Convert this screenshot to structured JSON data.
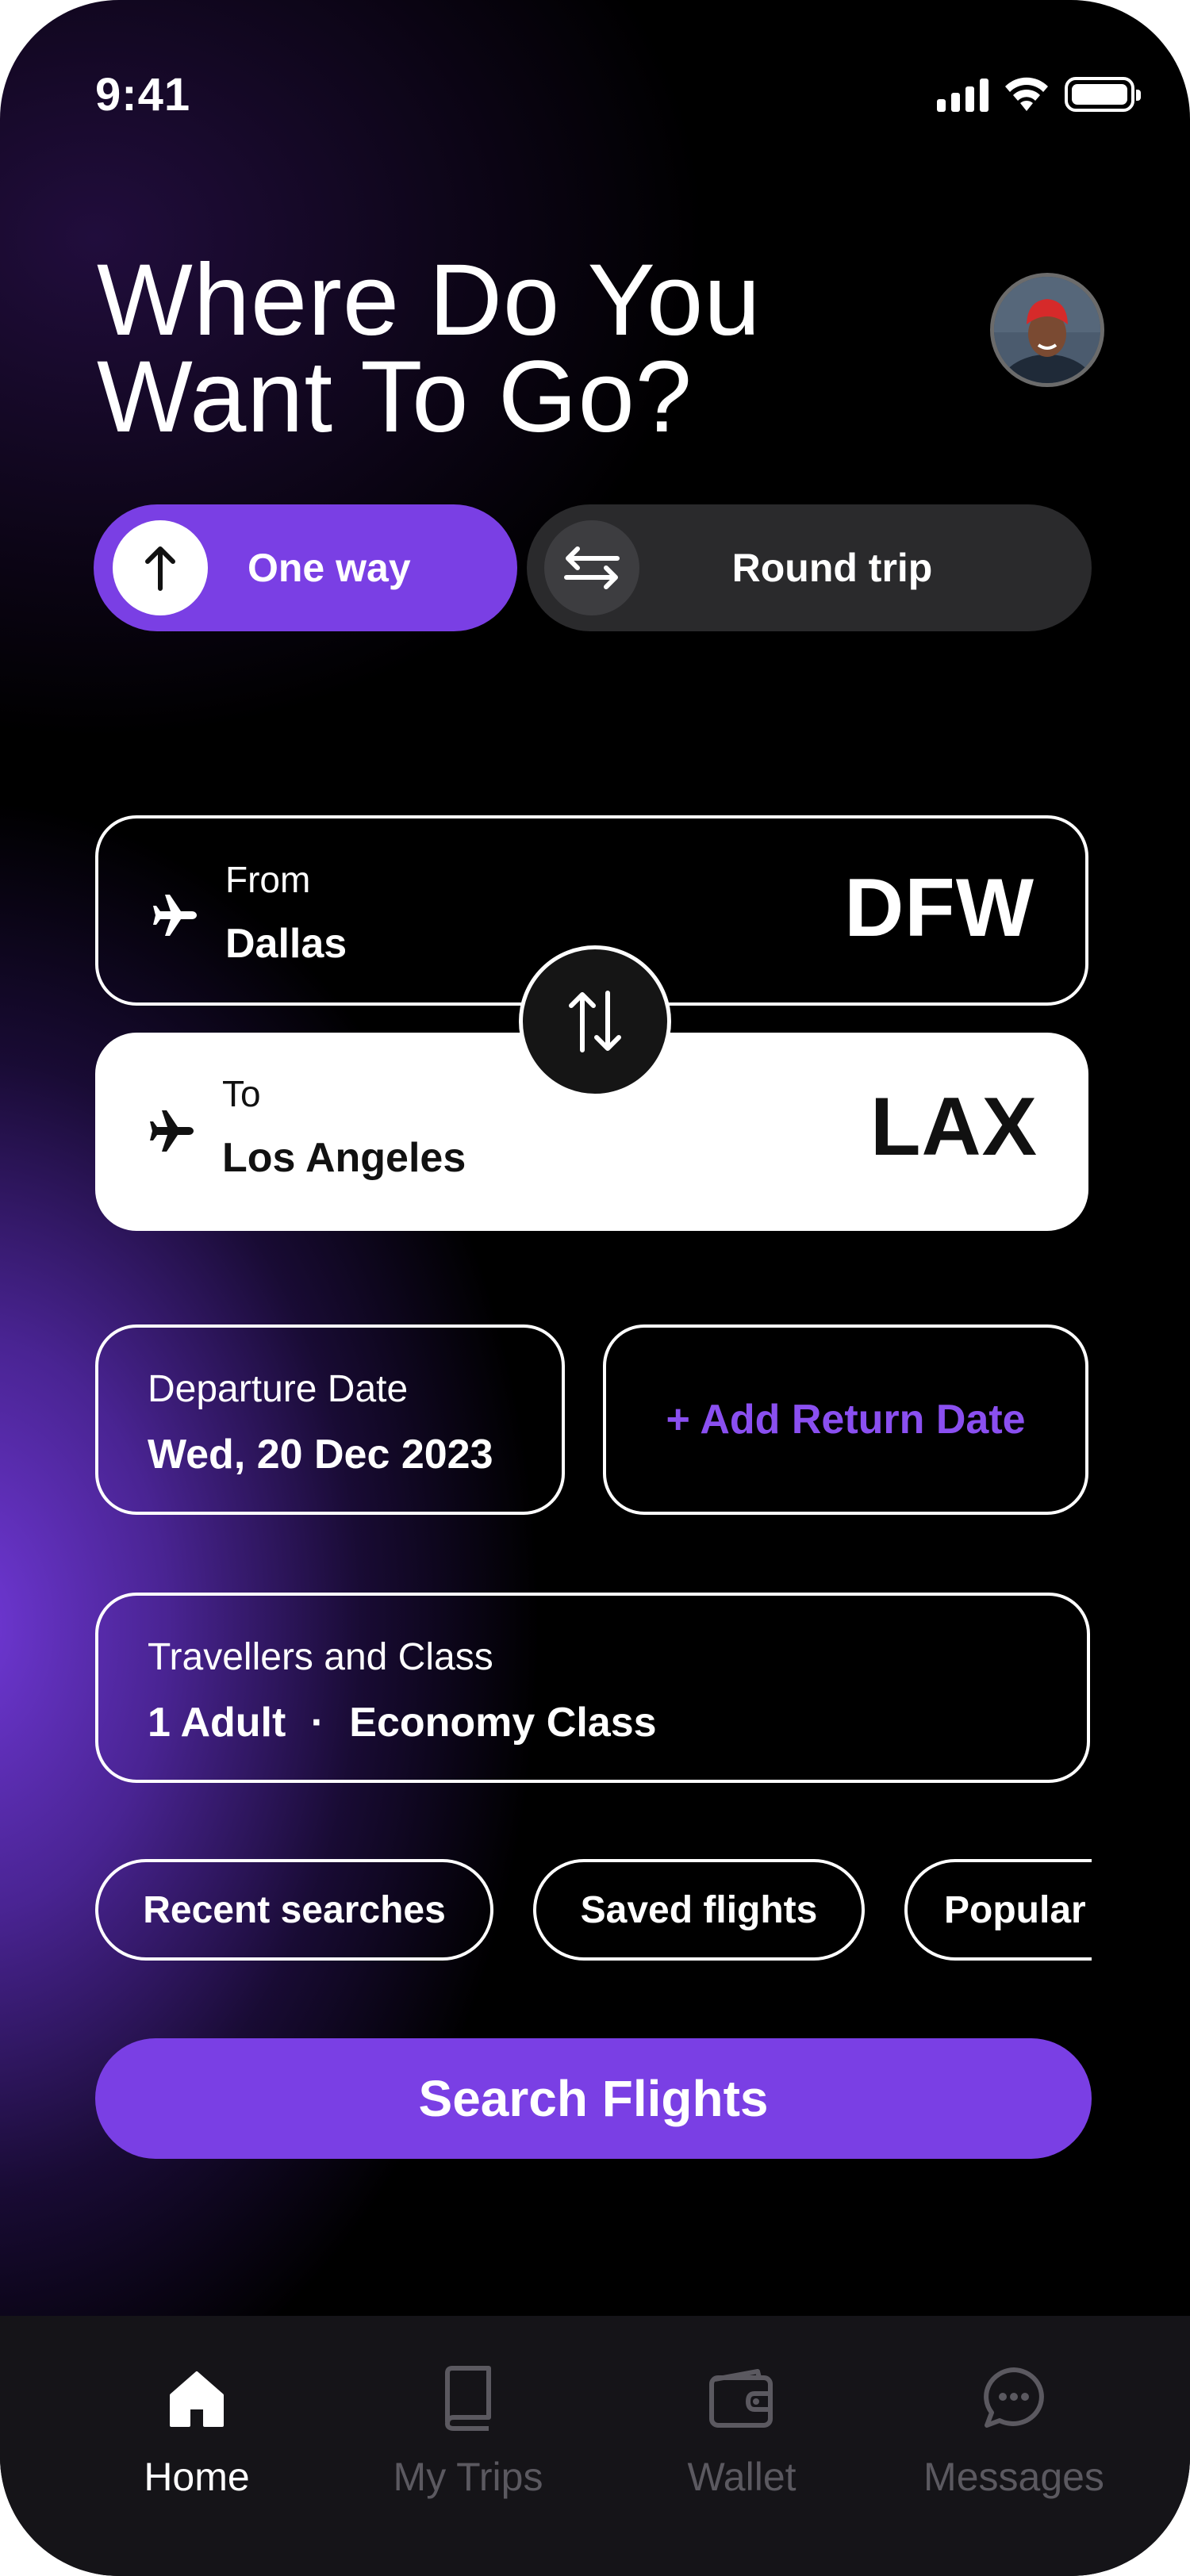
{
  "status_bar": {
    "time": "9:41"
  },
  "header": {
    "title": "Where Do You\nWant To Go?"
  },
  "trip_type": {
    "one_way_label": "One way",
    "round_trip_label": "Round trip",
    "selected": "One way"
  },
  "route": {
    "from": {
      "label": "From",
      "city": "Dallas",
      "code": "DFW"
    },
    "to": {
      "label": "To",
      "city": "Los Angeles",
      "code": "LAX"
    }
  },
  "dates": {
    "departure_label": "Departure Date",
    "departure_value": "Wed, 20 Dec 2023",
    "add_return_label": "+ Add Return Date"
  },
  "travellers": {
    "label": "Travellers and Class",
    "adults": "1 Adult",
    "separator": "·",
    "class": "Economy Class"
  },
  "chips": {
    "recent": "Recent searches",
    "saved": "Saved flights",
    "popular": "Popular"
  },
  "search_button_label": "Search Flights",
  "nav": {
    "home": "Home",
    "trips": "My Trips",
    "wallet": "Wallet",
    "messages": "Messages",
    "active": "Home"
  },
  "colors": {
    "accent": "#7a3fe4",
    "accent_text": "#8a4ff0",
    "background": "#000000",
    "nav_background": "#151418",
    "inactive_nav": "#5b5960"
  },
  "icons": {
    "one_way": "arrow-up-icon",
    "round_trip": "swap-horizontal-icon",
    "swap_route": "swap-vertical-icon",
    "from_plane": "plane-icon",
    "to_plane": "plane-icon",
    "nav_home": "home-icon",
    "nav_trips": "book-icon",
    "nav_wallet": "wallet-icon",
    "nav_messages": "chat-bubble-icon"
  }
}
